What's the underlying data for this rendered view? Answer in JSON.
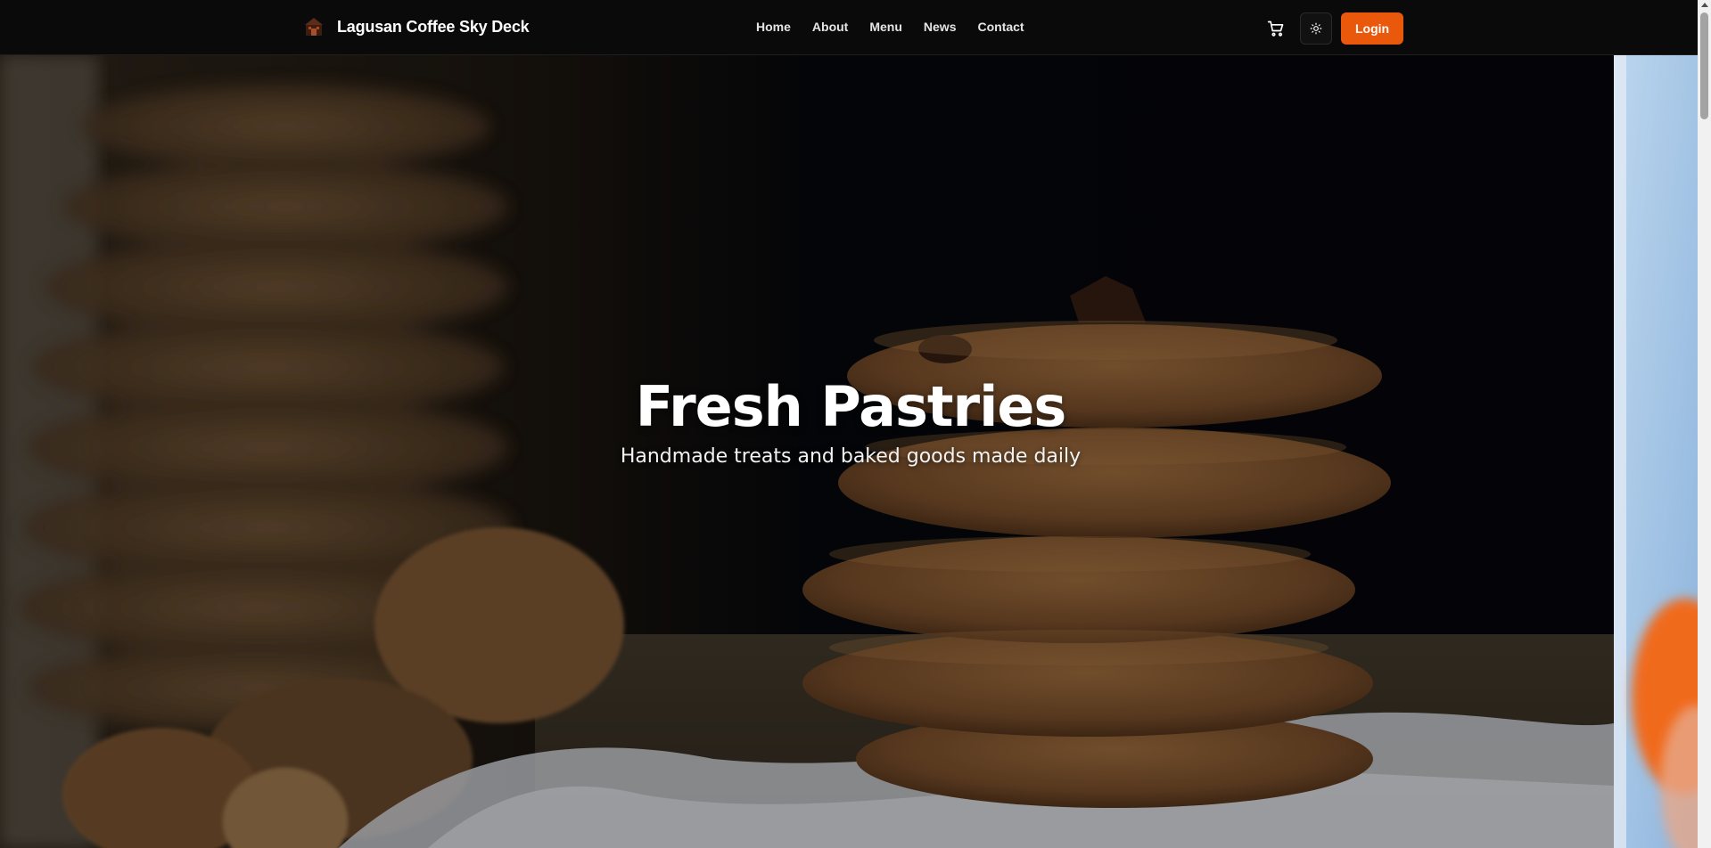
{
  "brand": {
    "name": "Lagusan Coffee Sky Deck",
    "icon": "coffee-shop-logo-icon"
  },
  "nav": {
    "items": [
      "Home",
      "About",
      "Menu",
      "News",
      "Contact"
    ]
  },
  "actions": {
    "cart_icon": "cart-icon",
    "theme_icon": "sun-icon",
    "login_label": "Login"
  },
  "hero": {
    "title": "Fresh Pastries",
    "subtitle": "Handmade treats and baked goods made daily"
  },
  "colors": {
    "accent": "#ea580c",
    "topbar_bg": "#0a0a0a",
    "text": "#ffffff"
  }
}
